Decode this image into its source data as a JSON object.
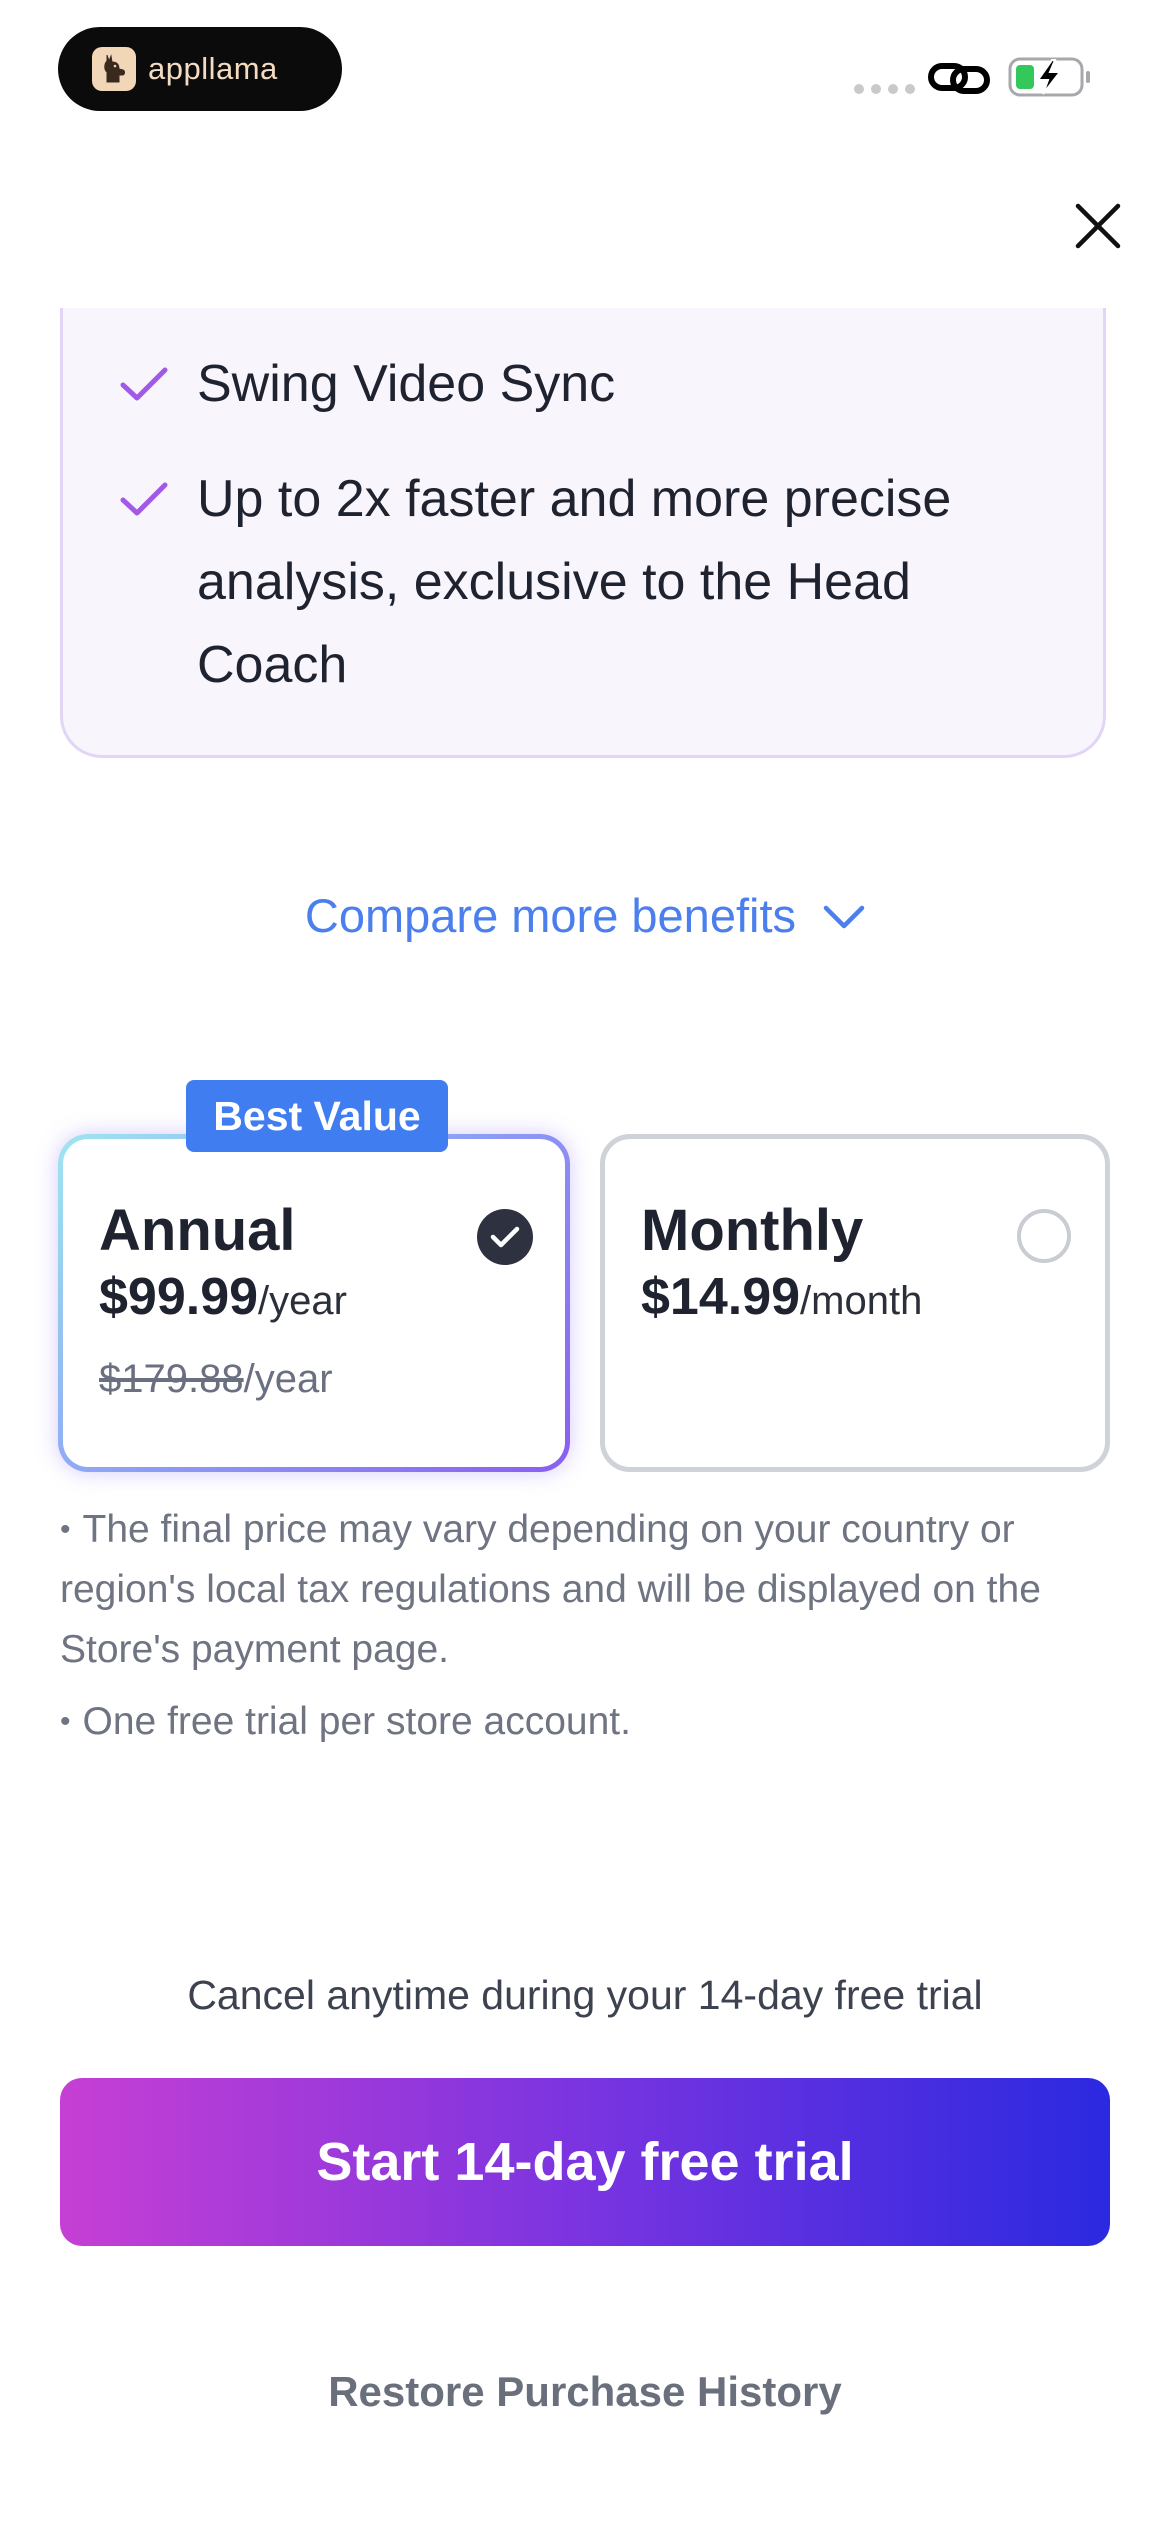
{
  "status_bar": {
    "app_name": "appllama"
  },
  "header": {
    "close_icon": "close-icon"
  },
  "benefits": {
    "items": [
      {
        "label": "Swing Video Sync"
      },
      {
        "label": "Up to 2x faster and more precise analysis, exclusive to the Head Coach"
      }
    ]
  },
  "compare": {
    "label": "Compare more benefits"
  },
  "plans": {
    "badge": "Best Value",
    "annual": {
      "name": "Annual",
      "price": "$99.99",
      "unit": "/year",
      "old_price": "$179.88",
      "old_unit": "/year",
      "selected": true
    },
    "monthly": {
      "name": "Monthly",
      "price": "$14.99",
      "unit": "/month",
      "selected": false
    }
  },
  "notes": [
    "The final price may vary depending on your country or region's local tax regulations and will be displayed on the Store's payment page.",
    "One free trial per store account."
  ],
  "footer": {
    "cancel_text": "Cancel anytime during your 14-day free trial",
    "cta_label": "Start 14-day free trial",
    "restore_label": "Restore Purchase History"
  },
  "colors": {
    "accent_link": "#4b7fee",
    "badge": "#3f7df0",
    "check": "#a159e6",
    "cta_gradient_start": "#c63fd4",
    "cta_gradient_end": "#2b29e0"
  }
}
